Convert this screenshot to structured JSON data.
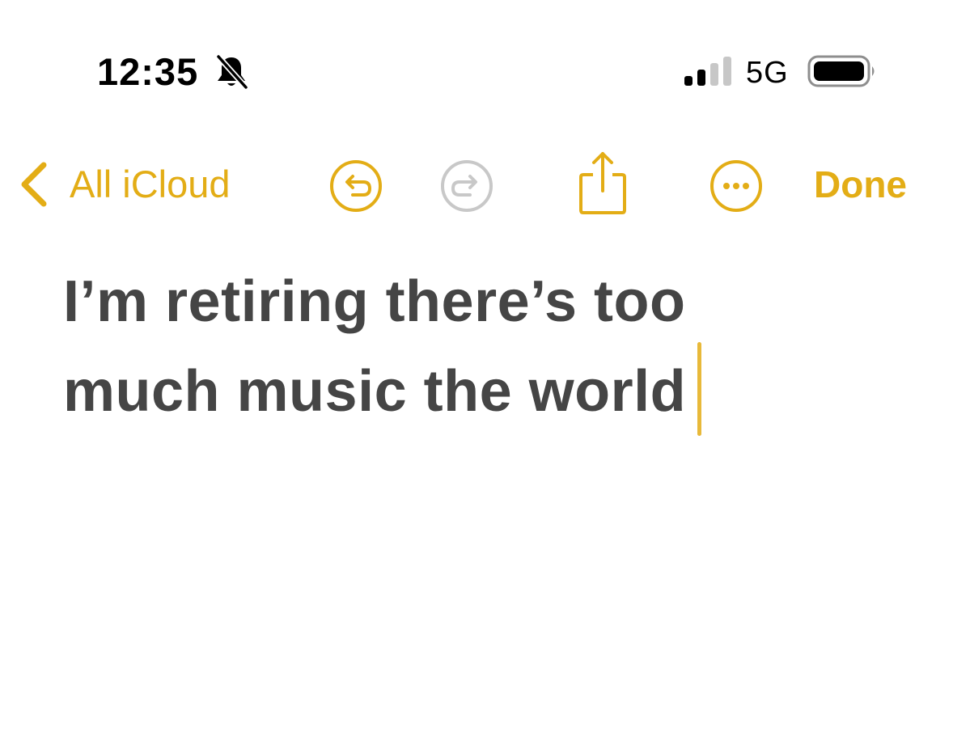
{
  "status_bar": {
    "time": "12:35",
    "network": "5G",
    "icons": [
      "bell-slash-icon",
      "cellular-signal-icon",
      "battery-icon"
    ]
  },
  "nav": {
    "back_label": "All iCloud",
    "done_label": "Done",
    "icons": [
      "chevron-left-icon",
      "undo-icon",
      "redo-icon",
      "share-icon",
      "more-icon"
    ]
  },
  "note": {
    "line1": "I’m retiring there’s too",
    "line2": "much music the world"
  },
  "colors": {
    "accent": "#e3ad16",
    "disabled": "#c8c8c8",
    "text": "#454545"
  }
}
